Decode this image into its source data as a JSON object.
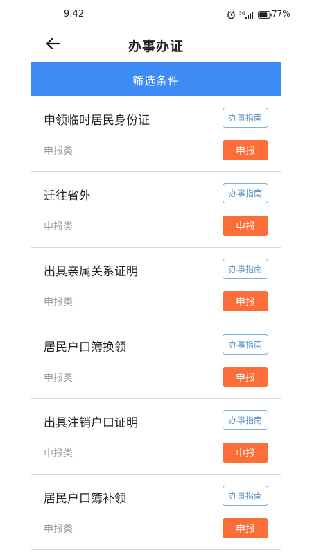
{
  "status_bar": {
    "time": "9:42",
    "network": "5G",
    "battery": "77%",
    "icons": [
      "alarm-icon",
      "signal-icon",
      "battery-icon"
    ]
  },
  "header": {
    "back_icon": "arrow-left-icon",
    "title": "办事办证"
  },
  "filter": {
    "label": "筛选条件",
    "color": "#3d8cf5"
  },
  "items": [
    {
      "title": "申领临时居民身份证",
      "category": "申报类",
      "guide": "办事指南",
      "apply": "申报"
    },
    {
      "title": "迁往省外",
      "category": "申报类",
      "guide": "办事指南",
      "apply": "申报"
    },
    {
      "title": "出具亲属关系证明",
      "category": "申报类",
      "guide": "办事指南",
      "apply": "申报"
    },
    {
      "title": "居民户口簿换领",
      "category": "申报类",
      "guide": "办事指南",
      "apply": "申报"
    },
    {
      "title": "出具注销户口证明",
      "category": "申报类",
      "guide": "办事指南",
      "apply": "申报"
    },
    {
      "title": "居民户口簿补领",
      "category": "申报类",
      "guide": "办事指南",
      "apply": "申报"
    }
  ],
  "colors": {
    "apply_button": "#fd6d37",
    "guide_border": "#7fb0d6"
  }
}
